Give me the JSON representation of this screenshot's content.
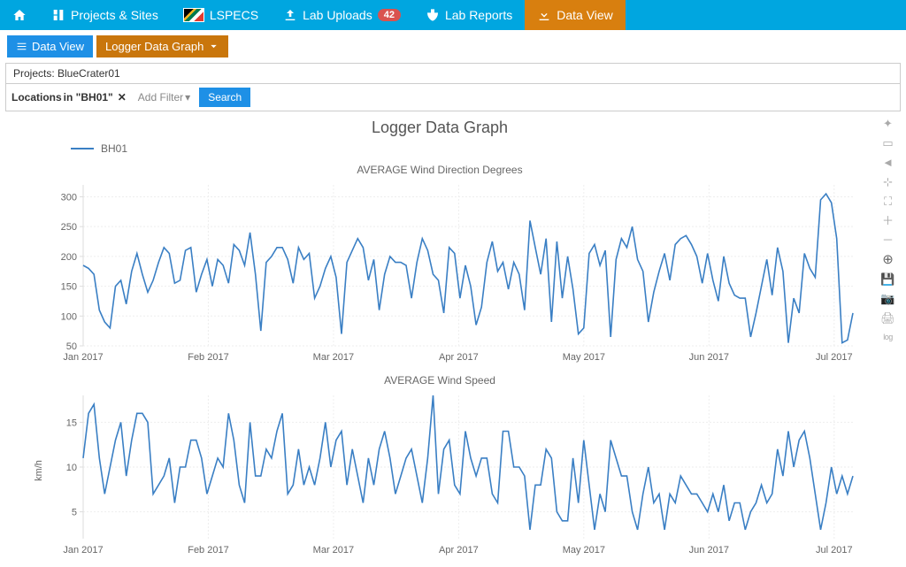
{
  "nav": {
    "home": "",
    "projects": "Projects & Sites",
    "lspecs": "LSPECS",
    "uploads": "Lab Uploads",
    "uploads_badge": "42",
    "reports": "Lab Reports",
    "dataview": "Data View"
  },
  "secondary": {
    "dataview": "Data View",
    "logger": "Logger Data Graph"
  },
  "context": {
    "projects_label": "Projects: BlueCrater01",
    "filter_prefix": "Locations ",
    "filter_in": "in \"BH01\"",
    "addfilter": "Add Filter",
    "search": "Search"
  },
  "chart_title": "Logger Data Graph",
  "legend_series": "BH01",
  "toolbox": {
    "lasso": "lasso",
    "zoomrect": "zoomrect",
    "pan": "pan",
    "reset": "reset",
    "fullscreen": "fullscreen",
    "zoomin": "zoomin",
    "zoomout": "zoomout",
    "autoscale": "autoscale",
    "save": "save",
    "camera": "camera",
    "print": "print",
    "log": "log"
  },
  "chart_data": [
    {
      "type": "line",
      "title": "AVERAGE Wind Direction Degrees",
      "ylabel": "",
      "ylim": [
        50,
        320
      ],
      "x_ticks": [
        "Jan 2017",
        "Feb 2017",
        "Mar 2017",
        "Apr 2017",
        "May 2017",
        "Jun 2017",
        "Jul 2017"
      ],
      "y_ticks": [
        50,
        100,
        150,
        200,
        250,
        300
      ],
      "series": [
        {
          "name": "BH01",
          "values": [
            185,
            180,
            170,
            110,
            90,
            80,
            150,
            160,
            120,
            175,
            205,
            170,
            140,
            160,
            190,
            215,
            205,
            155,
            160,
            210,
            215,
            140,
            170,
            195,
            150,
            195,
            185,
            155,
            220,
            210,
            185,
            240,
            170,
            75,
            190,
            200,
            215,
            215,
            195,
            155,
            215,
            195,
            205,
            130,
            150,
            180,
            200,
            165,
            70,
            190,
            210,
            230,
            215,
            160,
            195,
            110,
            170,
            200,
            190,
            190,
            185,
            130,
            190,
            230,
            210,
            170,
            160,
            105,
            215,
            205,
            130,
            185,
            150,
            85,
            115,
            190,
            225,
            175,
            190,
            145,
            190,
            170,
            110,
            260,
            215,
            170,
            230,
            90,
            225,
            130,
            200,
            145,
            70,
            80,
            205,
            220,
            185,
            210,
            65,
            195,
            230,
            215,
            250,
            195,
            175,
            90,
            140,
            175,
            205,
            160,
            220,
            230,
            235,
            220,
            200,
            155,
            205,
            160,
            125,
            200,
            155,
            135,
            130,
            130,
            65,
            105,
            150,
            195,
            135,
            215,
            175,
            55,
            130,
            105,
            205,
            180,
            165,
            295,
            305,
            290,
            230,
            55,
            60,
            105
          ]
        }
      ]
    },
    {
      "type": "line",
      "title": "AVERAGE Wind Speed",
      "ylabel": "km/h",
      "ylim": [
        2,
        18
      ],
      "x_ticks": [
        "Jan 2017",
        "Feb 2017",
        "Mar 2017",
        "Apr 2017",
        "May 2017",
        "Jun 2017",
        "Jul 2017"
      ],
      "y_ticks": [
        5,
        10,
        15
      ],
      "series": [
        {
          "name": "BH01",
          "values": [
            11,
            16,
            17,
            11,
            7,
            10,
            13,
            15,
            9,
            13,
            16,
            16,
            15,
            7,
            8,
            9,
            11,
            6,
            10,
            10,
            13,
            13,
            11,
            7,
            9,
            11,
            10,
            16,
            13,
            8,
            6,
            15,
            9,
            9,
            12,
            11,
            14,
            16,
            7,
            8,
            12,
            8,
            10,
            8,
            11,
            15,
            10,
            13,
            14,
            8,
            12,
            9,
            6,
            11,
            8,
            12,
            14,
            11,
            7,
            9,
            11,
            12,
            9,
            6,
            11,
            18,
            7,
            12,
            13,
            8,
            7,
            14,
            11,
            9,
            11,
            11,
            7,
            6,
            14,
            14,
            10,
            10,
            9,
            3,
            8,
            8,
            12,
            11,
            5,
            4,
            4,
            11,
            6,
            13,
            8,
            3,
            7,
            5,
            13,
            11,
            9,
            9,
            5,
            3,
            7,
            10,
            6,
            7,
            3,
            7,
            6,
            9,
            8,
            7,
            7,
            6,
            5,
            7,
            5,
            8,
            4,
            6,
            6,
            3,
            5,
            6,
            8,
            6,
            7,
            12,
            9,
            14,
            10,
            13,
            14,
            11,
            7,
            3,
            6,
            10,
            7,
            9,
            7,
            9
          ]
        }
      ]
    }
  ]
}
